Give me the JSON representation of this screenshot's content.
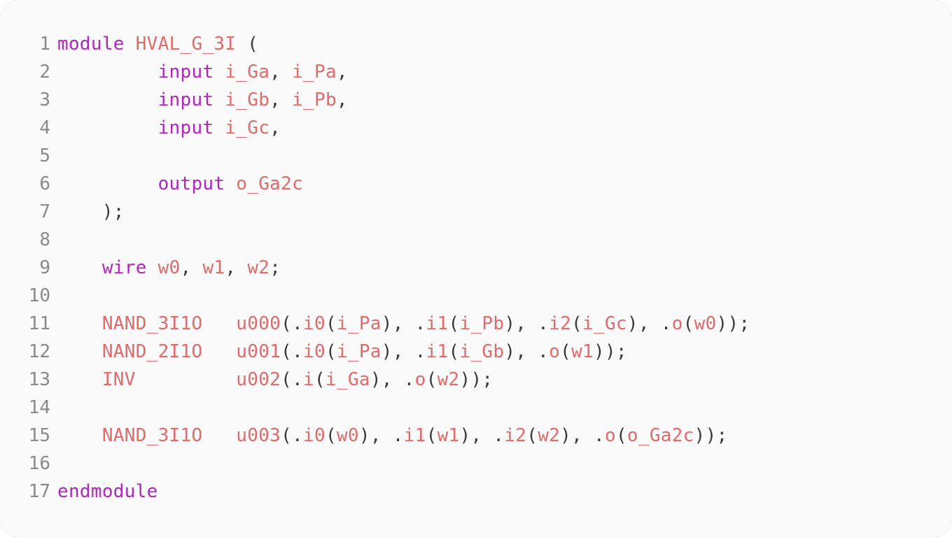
{
  "editor": {
    "language": "verilog",
    "background_color": "#fafafa",
    "accent_color": "#ee1c25",
    "gutter_color": "#8a8a8a",
    "keyword_color": "#b026bd",
    "identifier_color": "#e26a6a",
    "punctuation_color": "#3a3a3a",
    "total_lines": 17
  },
  "lines": [
    {
      "number": "1",
      "text": "module HVAL_G_3I (",
      "tokens": [
        {
          "t": "module",
          "k": "keyword"
        },
        {
          "t": " ",
          "k": "plain"
        },
        {
          "t": "HVAL_G_3I",
          "k": "ident"
        },
        {
          "t": " (",
          "k": "punct"
        }
      ]
    },
    {
      "number": "2",
      "text": "         input i_Ga, i_Pa,",
      "tokens": [
        {
          "t": "         ",
          "k": "plain"
        },
        {
          "t": "input",
          "k": "keyword"
        },
        {
          "t": " ",
          "k": "plain"
        },
        {
          "t": "i_Ga",
          "k": "ident"
        },
        {
          "t": ", ",
          "k": "punct"
        },
        {
          "t": "i_Pa",
          "k": "ident"
        },
        {
          "t": ",",
          "k": "punct"
        }
      ]
    },
    {
      "number": "3",
      "text": "         input i_Gb, i_Pb,",
      "tokens": [
        {
          "t": "         ",
          "k": "plain"
        },
        {
          "t": "input",
          "k": "keyword"
        },
        {
          "t": " ",
          "k": "plain"
        },
        {
          "t": "i_Gb",
          "k": "ident"
        },
        {
          "t": ", ",
          "k": "punct"
        },
        {
          "t": "i_Pb",
          "k": "ident"
        },
        {
          "t": ",",
          "k": "punct"
        }
      ]
    },
    {
      "number": "4",
      "text": "         input i_Gc,",
      "tokens": [
        {
          "t": "         ",
          "k": "plain"
        },
        {
          "t": "input",
          "k": "keyword"
        },
        {
          "t": " ",
          "k": "plain"
        },
        {
          "t": "i_Gc",
          "k": "ident"
        },
        {
          "t": ",",
          "k": "punct"
        }
      ]
    },
    {
      "number": "5",
      "text": "",
      "tokens": []
    },
    {
      "number": "6",
      "text": "         output o_Ga2c",
      "tokens": [
        {
          "t": "         ",
          "k": "plain"
        },
        {
          "t": "output",
          "k": "keyword"
        },
        {
          "t": " ",
          "k": "plain"
        },
        {
          "t": "o_Ga2c",
          "k": "ident"
        }
      ]
    },
    {
      "number": "7",
      "text": "    );",
      "tokens": [
        {
          "t": "    );",
          "k": "punct"
        }
      ]
    },
    {
      "number": "8",
      "text": "",
      "tokens": []
    },
    {
      "number": "9",
      "text": "    wire w0, w1, w2;",
      "tokens": [
        {
          "t": "    ",
          "k": "plain"
        },
        {
          "t": "wire",
          "k": "keyword"
        },
        {
          "t": " ",
          "k": "plain"
        },
        {
          "t": "w0",
          "k": "ident"
        },
        {
          "t": ", ",
          "k": "punct"
        },
        {
          "t": "w1",
          "k": "ident"
        },
        {
          "t": ", ",
          "k": "punct"
        },
        {
          "t": "w2",
          "k": "ident"
        },
        {
          "t": ";",
          "k": "punct"
        }
      ]
    },
    {
      "number": "10",
      "text": "",
      "tokens": []
    },
    {
      "number": "11",
      "text": "    NAND_3I1O   u000(.i0(i_Pa), .i1(i_Pb), .i2(i_Gc), .o(w0));",
      "tokens": [
        {
          "t": "    ",
          "k": "plain"
        },
        {
          "t": "NAND_3I1O",
          "k": "ident"
        },
        {
          "t": "   ",
          "k": "plain"
        },
        {
          "t": "u000",
          "k": "ident"
        },
        {
          "t": "(.",
          "k": "punct"
        },
        {
          "t": "i0",
          "k": "ident"
        },
        {
          "t": "(",
          "k": "punct"
        },
        {
          "t": "i_Pa",
          "k": "ident"
        },
        {
          "t": "), .",
          "k": "punct"
        },
        {
          "t": "i1",
          "k": "ident"
        },
        {
          "t": "(",
          "k": "punct"
        },
        {
          "t": "i_Pb",
          "k": "ident"
        },
        {
          "t": "), .",
          "k": "punct"
        },
        {
          "t": "i2",
          "k": "ident"
        },
        {
          "t": "(",
          "k": "punct"
        },
        {
          "t": "i_Gc",
          "k": "ident"
        },
        {
          "t": "), .",
          "k": "punct"
        },
        {
          "t": "o",
          "k": "ident"
        },
        {
          "t": "(",
          "k": "punct"
        },
        {
          "t": "w0",
          "k": "ident"
        },
        {
          "t": "));",
          "k": "punct"
        }
      ]
    },
    {
      "number": "12",
      "text": "    NAND_2I1O   u001(.i0(i_Pa), .i1(i_Gb), .o(w1));",
      "tokens": [
        {
          "t": "    ",
          "k": "plain"
        },
        {
          "t": "NAND_2I1O",
          "k": "ident"
        },
        {
          "t": "   ",
          "k": "plain"
        },
        {
          "t": "u001",
          "k": "ident"
        },
        {
          "t": "(.",
          "k": "punct"
        },
        {
          "t": "i0",
          "k": "ident"
        },
        {
          "t": "(",
          "k": "punct"
        },
        {
          "t": "i_Pa",
          "k": "ident"
        },
        {
          "t": "), .",
          "k": "punct"
        },
        {
          "t": "i1",
          "k": "ident"
        },
        {
          "t": "(",
          "k": "punct"
        },
        {
          "t": "i_Gb",
          "k": "ident"
        },
        {
          "t": "), .",
          "k": "punct"
        },
        {
          "t": "o",
          "k": "ident"
        },
        {
          "t": "(",
          "k": "punct"
        },
        {
          "t": "w1",
          "k": "ident"
        },
        {
          "t": "));",
          "k": "punct"
        }
      ]
    },
    {
      "number": "13",
      "text": "    INV         u002(.i(i_Ga), .o(w2));",
      "tokens": [
        {
          "t": "    ",
          "k": "plain"
        },
        {
          "t": "INV",
          "k": "ident"
        },
        {
          "t": "         ",
          "k": "plain"
        },
        {
          "t": "u002",
          "k": "ident"
        },
        {
          "t": "(.",
          "k": "punct"
        },
        {
          "t": "i",
          "k": "ident"
        },
        {
          "t": "(",
          "k": "punct"
        },
        {
          "t": "i_Ga",
          "k": "ident"
        },
        {
          "t": "), .",
          "k": "punct"
        },
        {
          "t": "o",
          "k": "ident"
        },
        {
          "t": "(",
          "k": "punct"
        },
        {
          "t": "w2",
          "k": "ident"
        },
        {
          "t": "));",
          "k": "punct"
        }
      ]
    },
    {
      "number": "14",
      "text": "",
      "tokens": []
    },
    {
      "number": "15",
      "text": "    NAND_3I1O   u003(.i0(w0), .i1(w1), .i2(w2), .o(o_Ga2c));",
      "tokens": [
        {
          "t": "    ",
          "k": "plain"
        },
        {
          "t": "NAND_3I1O",
          "k": "ident"
        },
        {
          "t": "   ",
          "k": "plain"
        },
        {
          "t": "u003",
          "k": "ident"
        },
        {
          "t": "(.",
          "k": "punct"
        },
        {
          "t": "i0",
          "k": "ident"
        },
        {
          "t": "(",
          "k": "punct"
        },
        {
          "t": "w0",
          "k": "ident"
        },
        {
          "t": "), .",
          "k": "punct"
        },
        {
          "t": "i1",
          "k": "ident"
        },
        {
          "t": "(",
          "k": "punct"
        },
        {
          "t": "w1",
          "k": "ident"
        },
        {
          "t": "), .",
          "k": "punct"
        },
        {
          "t": "i2",
          "k": "ident"
        },
        {
          "t": "(",
          "k": "punct"
        },
        {
          "t": "w2",
          "k": "ident"
        },
        {
          "t": "), .",
          "k": "punct"
        },
        {
          "t": "o",
          "k": "ident"
        },
        {
          "t": "(",
          "k": "punct"
        },
        {
          "t": "o_Ga2c",
          "k": "ident"
        },
        {
          "t": "));",
          "k": "punct"
        }
      ]
    },
    {
      "number": "16",
      "text": "",
      "tokens": []
    },
    {
      "number": "17",
      "text": "endmodule",
      "tokens": [
        {
          "t": "endmodule",
          "k": "keyword"
        }
      ]
    }
  ]
}
